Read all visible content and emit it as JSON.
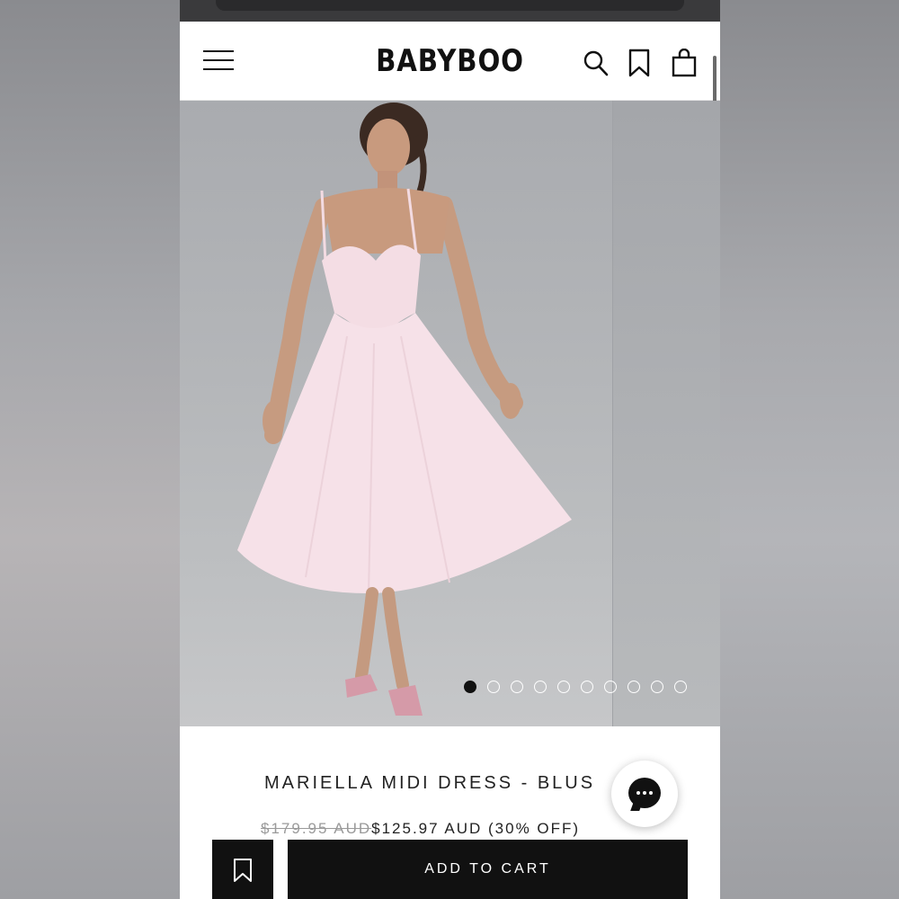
{
  "header": {
    "logo": "BABYBOO",
    "icons": [
      "menu-icon",
      "search-icon",
      "bookmark-icon",
      "bag-icon"
    ]
  },
  "gallery": {
    "slide_count": 10,
    "active_index": 0
  },
  "product": {
    "title": "MARIELLA MIDI DRESS - BLUS",
    "original_price": "$179.95 AUD",
    "sale_price": "$125.97 AUD",
    "discount": "(30% OFF)"
  },
  "actions": {
    "add_to_cart_label": "ADD TO CART"
  },
  "colors": {
    "brand": "#111111",
    "dress": "#f6dfe6"
  }
}
